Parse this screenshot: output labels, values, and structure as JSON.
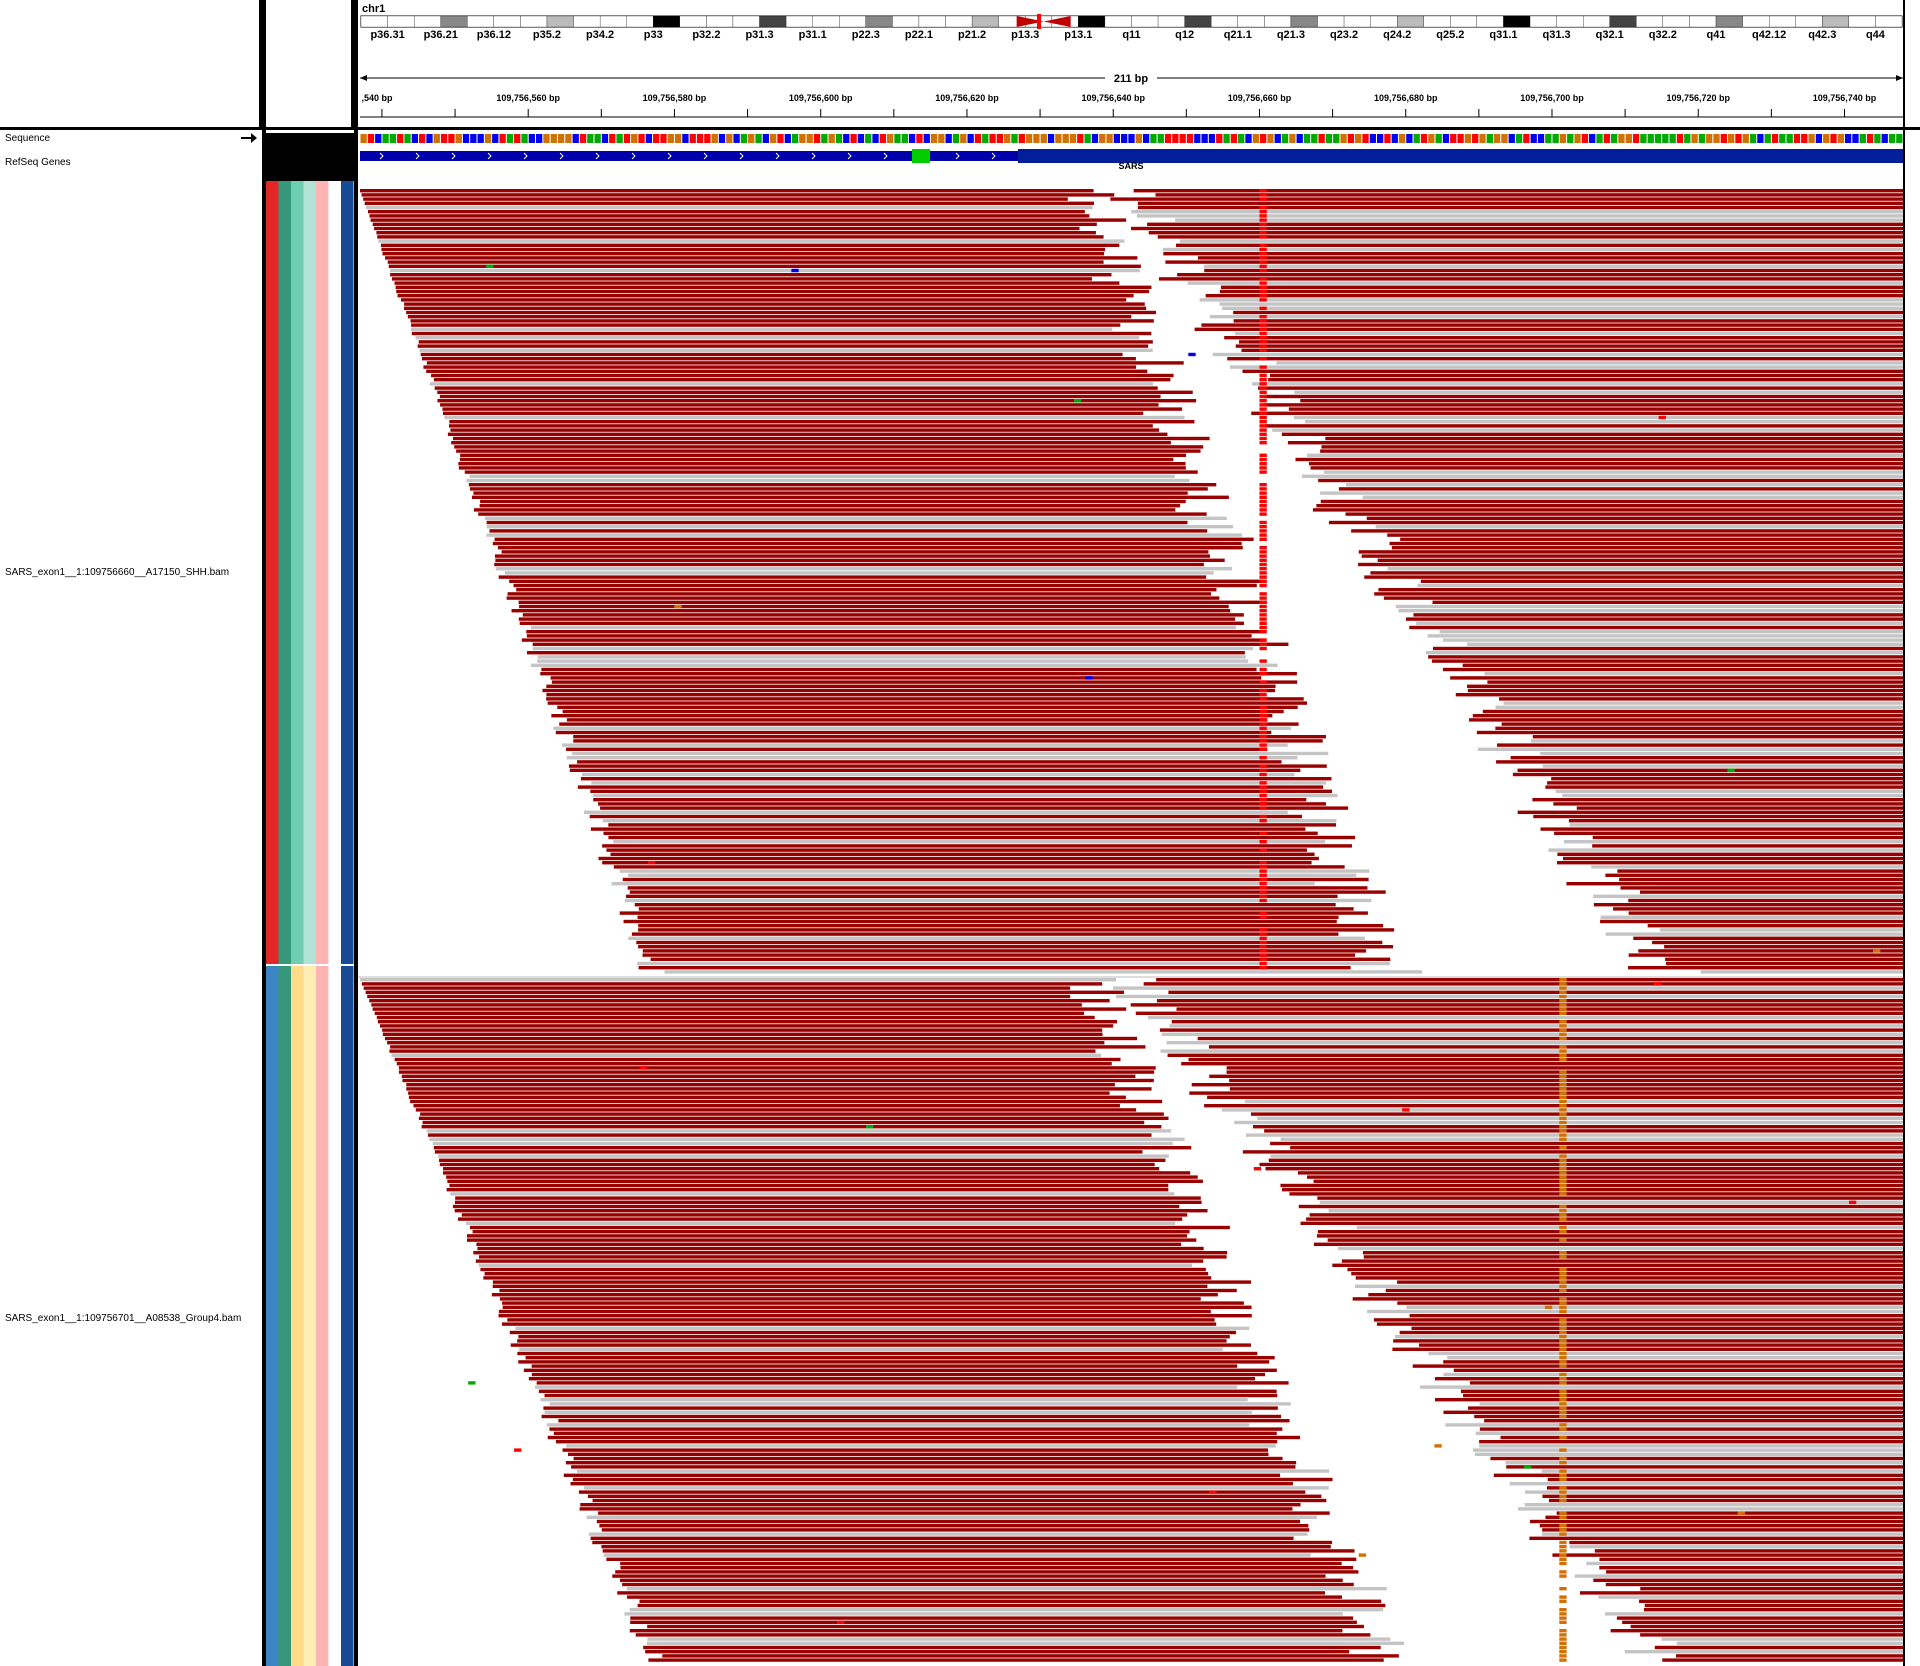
{
  "locus": {
    "chromosome": "chr1",
    "span_label": "211 bp",
    "range_start": 109756537,
    "range_end": 109756747,
    "tick_labels": [
      ",540 bp",
      "109,756,560 bp",
      "109,756,580 bp",
      "109,756,600 bp",
      "109,756,620 bp",
      "109,756,640 bp",
      "109,756,660 bp",
      "109,756,680 bp",
      "109,756,700 bp",
      "109,756,720 bp",
      "109,756,740 bp"
    ]
  },
  "ideogram": {
    "bands": [
      "p36.31",
      "p36.21",
      "p36.12",
      "p35.2",
      "p34.2",
      "p33",
      "p32.2",
      "p31.3",
      "p31.1",
      "p22.3",
      "p22.1",
      "p21.2",
      "p13.3",
      "p13.1",
      "q11",
      "q12",
      "q21.1",
      "q21.3",
      "q23.2",
      "q24.2",
      "q25.2",
      "q31.1",
      "q31.3",
      "q32.1",
      "q32.2",
      "q41",
      "q42.12",
      "q42.3",
      "q44"
    ],
    "current_region_color": "#ff0000"
  },
  "tracks": {
    "sequence_label": "Sequence",
    "refseq_label": "RefSeq Genes",
    "gene_name": "SARS",
    "alignment_1": "SARS_exon1__1:109756660__A17150_SHH.bam",
    "alignment_2": "SARS_exon1__1:109756701__A08538_Group4.bam"
  },
  "colors": {
    "read_forward": "#990000",
    "read_reverse": "#c4c4c4",
    "gene": "#0000aa",
    "mismatch_A": "#00aa00",
    "mismatch_C": "#0000ee",
    "mismatch_G": "#d17105",
    "mismatch_T": "#ff0000",
    "variant_column_1": "#ff0000",
    "variant_column_2": "#d17105"
  },
  "attributes": {
    "sample_1_colors": [
      "#e32626",
      "#35987a",
      "#6fcdb1",
      "#b1e3d4",
      "#ffb3b3",
      "#ffffff",
      "#174a94"
    ],
    "sample_2_colors": [
      "#3b86c2",
      "#35987a",
      "#ffdb8a",
      "#ffedb3",
      "#ffb3b3",
      "#ffffff",
      "#174a94"
    ]
  },
  "variants": [
    {
      "position": 109756660,
      "sample": 1
    },
    {
      "position": 109756701,
      "sample": 2
    }
  ]
}
